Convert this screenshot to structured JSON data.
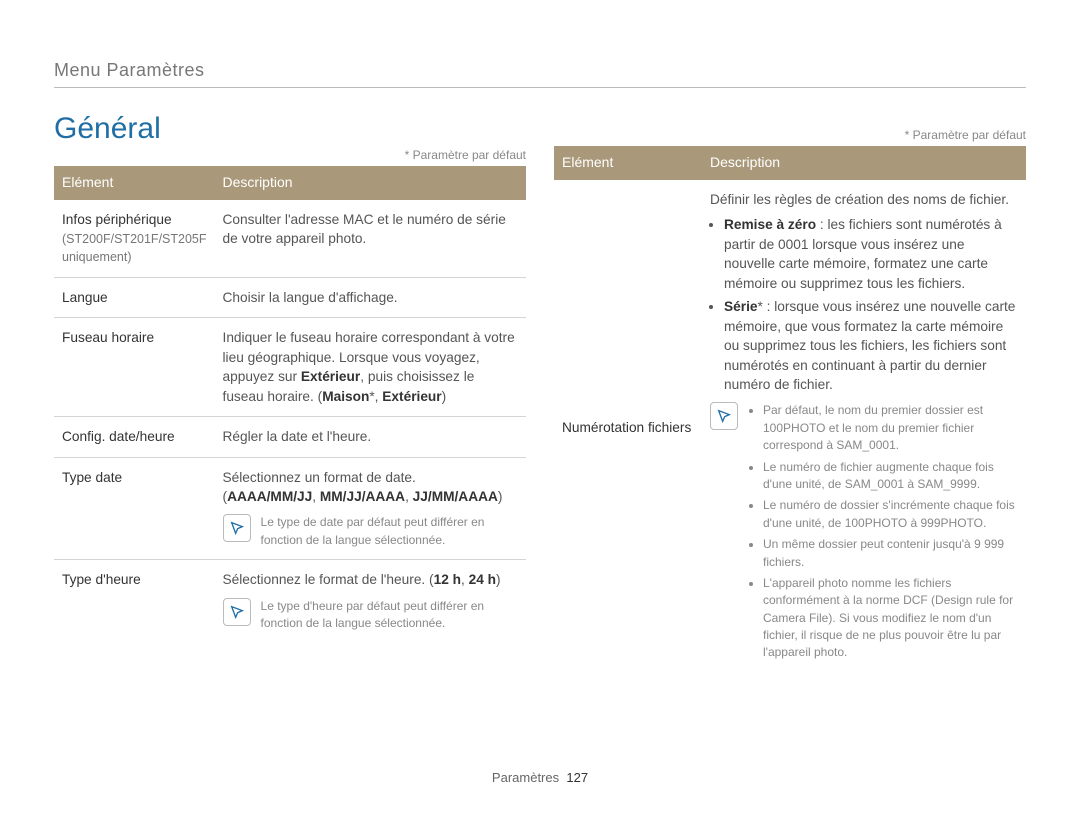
{
  "breadcrumb": "Menu Paramètres",
  "section_title": "Général",
  "default_caption": "* Paramètre par défaut",
  "headers": {
    "element": "Elément",
    "description": "Description"
  },
  "left_rows": {
    "r0": {
      "el": "Infos périphérique",
      "sub": "(ST200F/ST201F/ST205F uniquement)",
      "desc_a": "Consulter l'adresse MAC et le numéro de série de votre appareil photo."
    },
    "r1": {
      "el": "Langue",
      "desc_a": "Choisir la langue d'affichage."
    },
    "r2": {
      "el": "Fuseau horaire",
      "desc_a": "Indiquer le fuseau horaire correspondant à votre lieu géographique. Lorsque vous voyagez, appuyez sur ",
      "desc_b": "Extérieur",
      "desc_c": ", puis choisissez le fuseau horaire. (",
      "desc_d": "Maison",
      "desc_e": "*, ",
      "desc_f": "Extérieur",
      "desc_g": ")"
    },
    "r3": {
      "el": "Config. date/heure",
      "desc_a": "Régler la date et l'heure."
    },
    "r4": {
      "el": "Type date",
      "desc_a": "Sélectionnez un format de date.",
      "opt_open": "(",
      "opt1": "AAAA/MM/JJ",
      "sep": ", ",
      "opt2": "MM/JJ/AAAA",
      "opt3": "JJ/MM/AAAA",
      "opt_close": ")",
      "note": "Le type de date par défaut peut différer en fonction de la langue sélectionnée."
    },
    "r5": {
      "el": "Type d'heure",
      "desc_a": "Sélectionnez le format de l'heure. (",
      "opt1": "12 h",
      "sep": ", ",
      "opt2": "24 h",
      "desc_b": ")",
      "note": "Le type d'heure par défaut peut différer en fonction de la langue sélectionnée."
    }
  },
  "right_rows": {
    "r0": {
      "el": "Numérotation fichiers",
      "lead": "Définir les règles de création des noms de fichier.",
      "b1_t": "Remise à zéro",
      "b1_c": " : les fichiers sont numérotés à partir de 0001 lorsque vous insérez une nouvelle carte mémoire, formatez une carte mémoire ou supprimez tous les fichiers.",
      "b2_t": "Série",
      "b2_s": "*",
      "b2_c": " : lorsque vous insérez une nouvelle carte mémoire, que vous formatez la carte mémoire ou supprimez tous les fichiers, les fichiers sont numérotés en continuant à partir du dernier numéro de fichier.",
      "notes": {
        "n1": "Par défaut, le nom du premier dossier est 100PHOTO et le nom du premier fichier correspond à SAM_0001.",
        "n2": "Le numéro de fichier augmente chaque fois d'une unité, de SAM_0001 à SAM_9999.",
        "n3": "Le numéro de dossier s'incrémente chaque fois d'une unité, de 100PHOTO à 999PHOTO.",
        "n4": "Un même dossier peut contenir jusqu'à 9 999 fichiers.",
        "n5": "L'appareil photo nomme les fichiers conformément à la norme DCF (Design rule for Camera File). Si vous modifiez le nom d'un fichier, il risque de ne plus pouvoir être lu par l'appareil photo."
      }
    }
  },
  "footer": {
    "section": "Paramètres",
    "page": "127"
  }
}
